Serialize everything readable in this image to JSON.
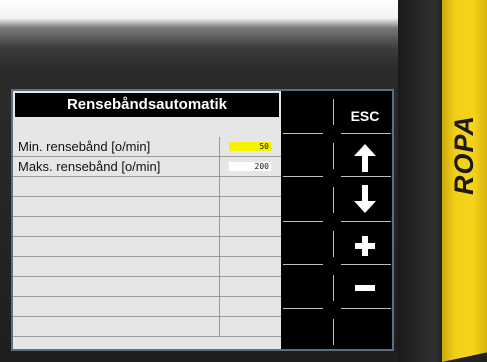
{
  "device": {
    "brand": "ROPA"
  },
  "screen": {
    "title": "Rensebåndsautomatik",
    "rows": [
      {
        "label": "Min. rensebånd [o/min]",
        "value": "50",
        "active": true
      },
      {
        "label": "Maks. rensebånd [o/min]",
        "value": "200",
        "active": false
      },
      {
        "label": "",
        "value": ""
      },
      {
        "label": "",
        "value": ""
      },
      {
        "label": "",
        "value": ""
      },
      {
        "label": "",
        "value": ""
      },
      {
        "label": "",
        "value": ""
      },
      {
        "label": "",
        "value": ""
      },
      {
        "label": "",
        "value": ""
      }
    ]
  },
  "softkeys": {
    "esc_label": "ESC",
    "up_icon": "arrow-up-icon",
    "down_icon": "arrow-down-icon",
    "plus_icon": "plus-icon",
    "minus_icon": "minus-icon"
  }
}
